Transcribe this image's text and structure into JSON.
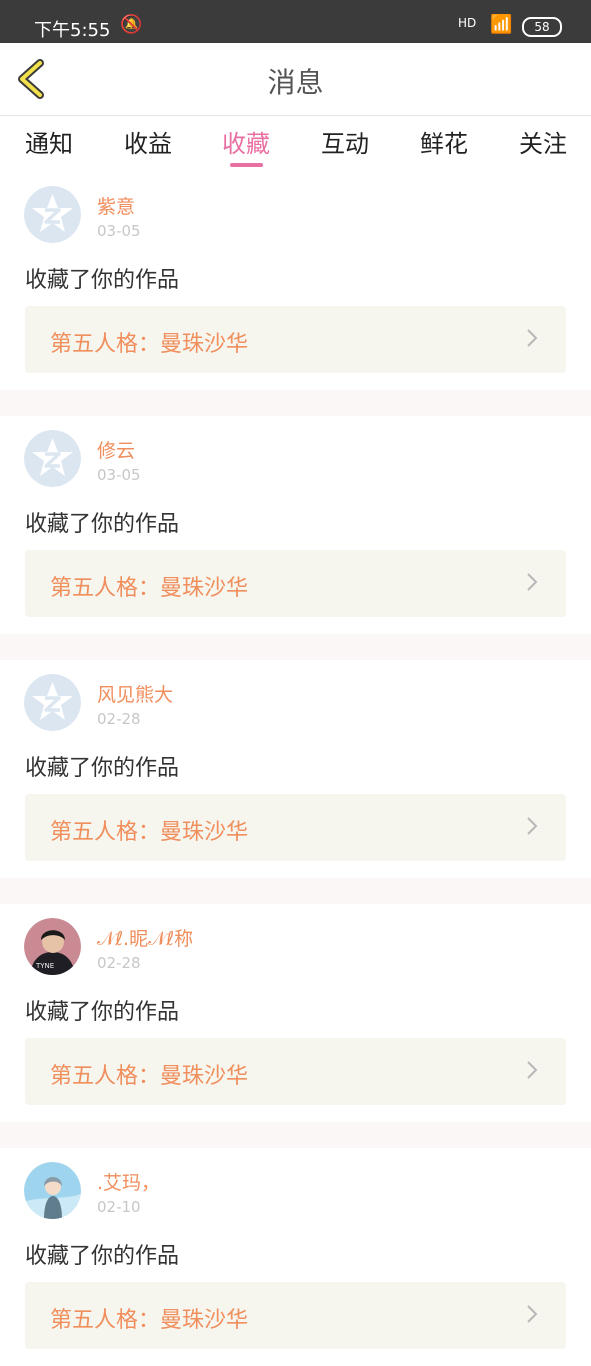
{
  "status_bar": {
    "time": "下午5:55",
    "network": "HD",
    "battery": "58"
  },
  "header": {
    "title": "消息"
  },
  "tabs": [
    {
      "label": "通知",
      "active": false
    },
    {
      "label": "收益",
      "active": false
    },
    {
      "label": "收藏",
      "active": true
    },
    {
      "label": "互动",
      "active": false
    },
    {
      "label": "鲜花",
      "active": false
    },
    {
      "label": "关注",
      "active": false
    }
  ],
  "colors": {
    "accent": "#e96fa3",
    "name": "#f08e5c",
    "card_bg": "#f6f5ee"
  },
  "messages": [
    {
      "user": "紫意",
      "date": "03-05",
      "action": "收藏了你的作品",
      "work": "第五人格：曼珠沙华",
      "avatar": "default-logo"
    },
    {
      "user": "修云",
      "date": "03-05",
      "action": "收藏了你的作品",
      "work": "第五人格：曼珠沙华",
      "avatar": "default-logo"
    },
    {
      "user": "风见熊大",
      "date": "02-28",
      "action": "收藏了你的作品",
      "work": "第五人格：曼珠沙华",
      "avatar": "default-logo"
    },
    {
      "user": "𝒩ℓ.昵𝒩ℓ称",
      "date": "02-28",
      "action": "收藏了你的作品",
      "work": "第五人格：曼珠沙华",
      "avatar": "photo-person"
    },
    {
      "user": ".艾玛，",
      "date": "02-10",
      "action": "收藏了你的作品",
      "work": "第五人格：曼珠沙华",
      "avatar": "photo-anime"
    }
  ]
}
